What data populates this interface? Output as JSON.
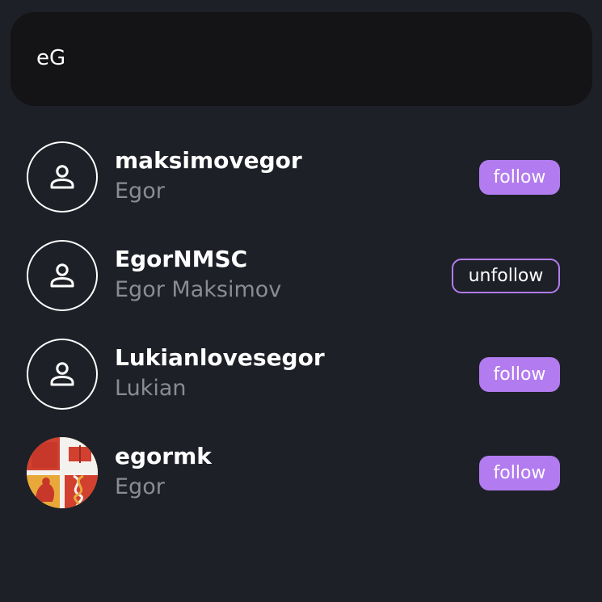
{
  "search": {
    "value": "eG",
    "placeholder": ""
  },
  "results": [
    {
      "username": "maksimovegor",
      "display_name": "Egor",
      "avatar": "person-icon",
      "action": "follow"
    },
    {
      "username": "EgorNMSC",
      "display_name": "Egor Maksimov",
      "avatar": "person-icon",
      "action": "unfollow"
    },
    {
      "username": "Lukianlovesegor",
      "display_name": "Lukian",
      "avatar": "person-icon",
      "action": "follow"
    },
    {
      "username": "egormk",
      "display_name": "Egor",
      "avatar": "coat-of-arms-photo",
      "action": "follow"
    }
  ],
  "colors": {
    "background": "#1e2027",
    "search_background": "#141417",
    "accent": "#b27cf0",
    "secondary_text": "#8a8c93"
  }
}
